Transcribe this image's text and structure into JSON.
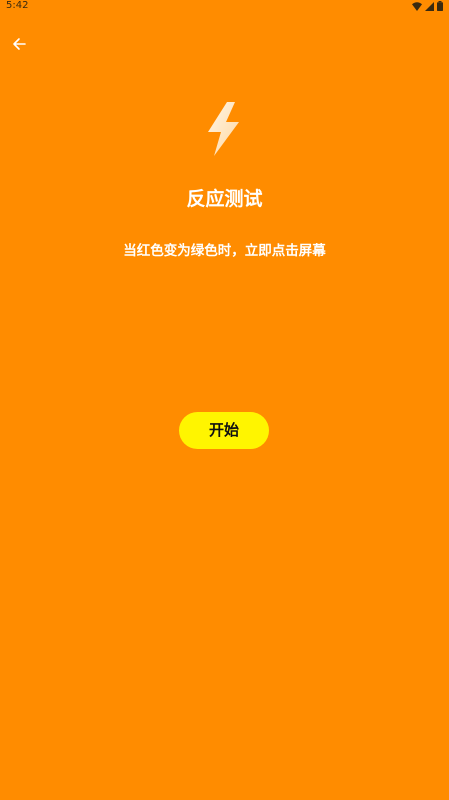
{
  "status_bar": {
    "time": "5:42",
    "icons": [
      "wifi-icon",
      "signal-icon",
      "battery-icon"
    ]
  },
  "header": {
    "back_icon": "arrow-left-icon"
  },
  "main": {
    "icon": "lightning-bolt-icon",
    "title": "反应测试",
    "instruction": "当红色变为绿色时，立即点击屏幕",
    "start_label": "开始"
  },
  "colors": {
    "background": "#FF8C00",
    "button": "#FFF500",
    "text": "#FFFFFF"
  }
}
